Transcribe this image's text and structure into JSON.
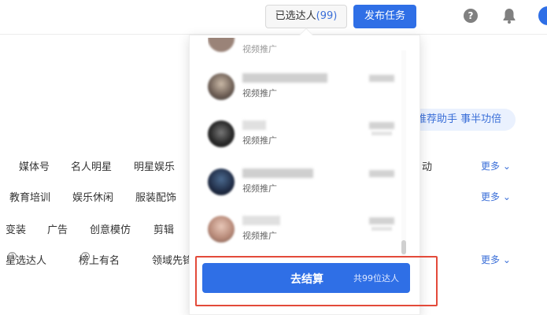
{
  "topbar": {
    "selected_label": "已选达人",
    "selected_count": "(99)",
    "publish_label": "发布任务",
    "help_glyph": "?"
  },
  "assistant": {
    "label": "推荐助手 事半功倍"
  },
  "categories": {
    "row1": [
      "媒体号",
      "名人明星",
      "明星娱乐",
      "动"
    ],
    "row2": [
      "教育培训",
      "娱乐休闲",
      "服装配饰"
    ],
    "row3": [
      "变装",
      "广告",
      "创意模仿",
      "剪辑"
    ],
    "row4": [
      "星选达人",
      "榜上有名",
      "领域先锋"
    ],
    "more_label": "更多 ⌄"
  },
  "panel": {
    "items": [
      {
        "type": "视频推广"
      },
      {
        "type": "视频推广"
      },
      {
        "type": "视频推广"
      },
      {
        "type": "视频推广"
      }
    ],
    "partial_type": "视频推广",
    "checkout_label": "去结算",
    "total_label": "共99位达人"
  },
  "colors": {
    "accent": "#2f6fe6",
    "highlight_border": "#e34a3a",
    "link": "#3b6fd8"
  },
  "icons": [
    "help-icon",
    "bell-icon",
    "user-avatar",
    "question-mark-icon",
    "chevron-down-icon"
  ]
}
